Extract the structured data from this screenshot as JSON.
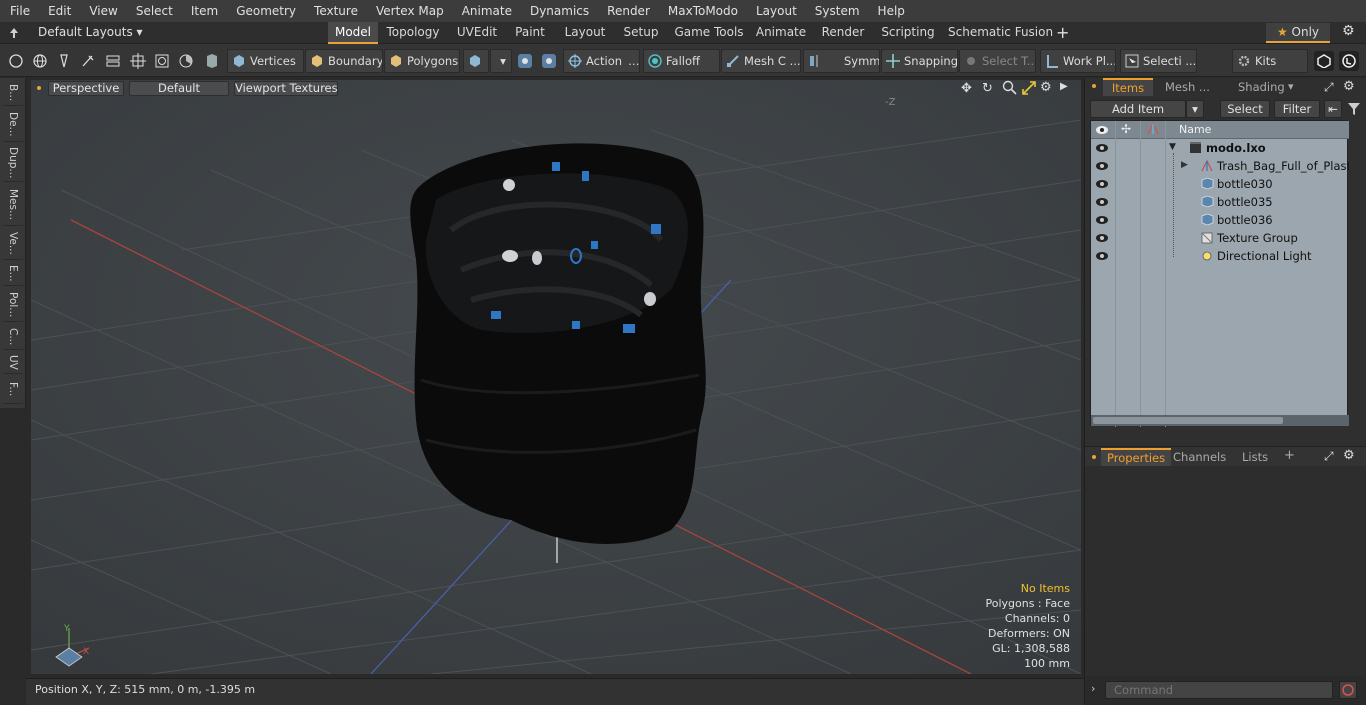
{
  "menu": [
    "File",
    "Edit",
    "View",
    "Select",
    "Item",
    "Geometry",
    "Texture",
    "Vertex Map",
    "Animate",
    "Dynamics",
    "Render",
    "MaxToModo",
    "Layout",
    "System",
    "Help"
  ],
  "layouts_label": "Default Layouts",
  "mode_tabs": [
    "Model",
    "Topology",
    "UVEdit",
    "Paint",
    "Layout",
    "Setup",
    "Game Tools",
    "Animate",
    "Render",
    "Scripting",
    "Schematic Fusion"
  ],
  "only_label": "Only",
  "toolbar": {
    "vertices": "Vertices",
    "boundary": "Boundary",
    "polygons": "Polygons",
    "action": "Action",
    "falloff": "Falloff",
    "mesh_c": "Mesh C ...",
    "symm": "Symm ...",
    "snapping": "Snapping",
    "select_t": "Select T...",
    "work_pl": "Work Pl...",
    "selecti": "Selecti ...",
    "kits": "Kits"
  },
  "left_tabs": [
    "B...",
    "De...",
    "Dup...",
    "Mes...",
    "Ve...",
    "E...",
    "Pol...",
    "C...",
    "UV",
    "F..."
  ],
  "viewport": {
    "perspective": "Perspective",
    "default": "Default",
    "textures": "Viewport Textures",
    "axis_neg_z": "-Z",
    "gizmo_y": "Y",
    "gizmo_x": "X"
  },
  "hud": {
    "items": "No Items",
    "polygons": "Polygons : Face",
    "channels": "Channels: 0",
    "deformers": "Deformers: ON",
    "gl": "GL: 1,308,588",
    "scale": "100 mm"
  },
  "status": "Position X, Y, Z:   515 mm, 0 m, -1.395 m",
  "right_tabs": {
    "items": "Items",
    "mesh": "Mesh ...",
    "shading": "Shading"
  },
  "items_buttons": {
    "add": "Add Item",
    "select": "Select",
    "filter": "Filter"
  },
  "list_header": "Name",
  "tree": [
    {
      "name": "modo.lxo"
    },
    {
      "name": "Trash_Bag_Full_of_Plast..."
    },
    {
      "name": "bottle030"
    },
    {
      "name": "bottle035"
    },
    {
      "name": "bottle036"
    },
    {
      "name": "Texture Group"
    },
    {
      "name": "Directional Light"
    }
  ],
  "prop_tabs": {
    "properties": "Properties",
    "channels": "Channels",
    "lists": "Lists"
  },
  "command_placeholder": "Command",
  "colors": {
    "accent": "#e8a33a",
    "viewport_bg": "#3d4246",
    "list_bg": "#9ca6ae"
  }
}
